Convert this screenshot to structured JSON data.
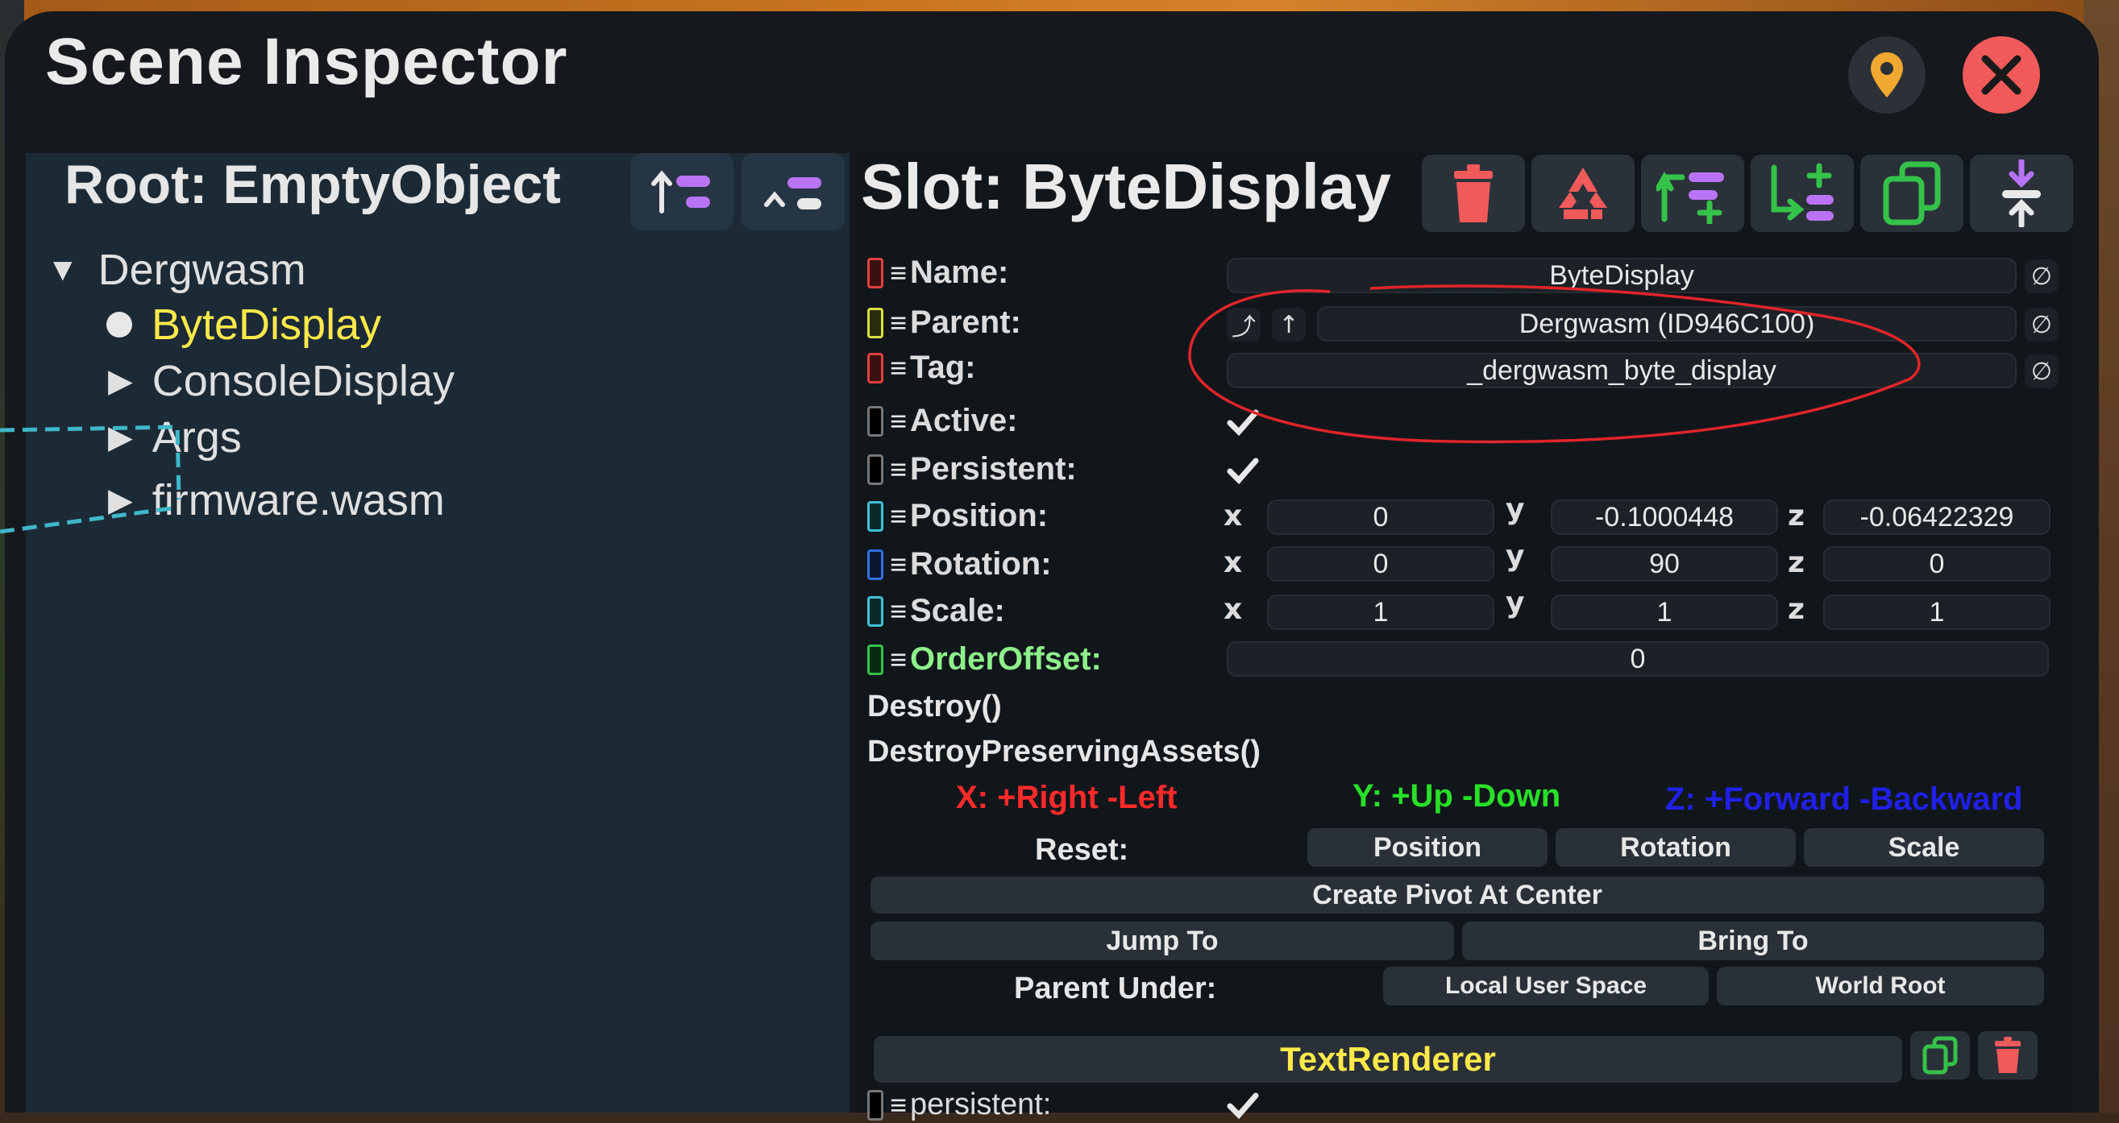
{
  "window": {
    "title": "Scene Inspector"
  },
  "colors": {
    "accent_yellow": "#ffe94a",
    "delete_red": "#f05a5a",
    "green_icon": "#35c24a",
    "purple_icon": "#b874f5",
    "highlight_circle": "#e0252a"
  },
  "hierarchy": {
    "root_label": "Root: EmptyObject",
    "items": [
      {
        "label": "Dergwasm",
        "expanded": true,
        "level": 0
      },
      {
        "label": "ByteDisplay",
        "selected": true,
        "level": 1
      },
      {
        "label": "ConsoleDisplay",
        "level": 1
      },
      {
        "label": "Args",
        "level": 1
      },
      {
        "label": "firmware.wasm",
        "level": 1
      }
    ]
  },
  "slot": {
    "title": "Slot: ByteDisplay",
    "toolbar_icons": [
      "delete-icon",
      "destroy-preserving-assets-icon",
      "insert-parent-icon",
      "add-child-icon",
      "duplicate-icon",
      "center-pivot-icon"
    ],
    "fields": {
      "name": {
        "label": "Name:",
        "value": "ByteDisplay"
      },
      "parent": {
        "label": "Parent:",
        "value": "Dergwasm (ID946C100)"
      },
      "tag": {
        "label": "Tag:",
        "value": "_dergwasm_byte_display"
      },
      "active": {
        "label": "Active:",
        "checked": true
      },
      "persistent": {
        "label": "Persistent:",
        "checked": true
      },
      "position": {
        "label": "Position:",
        "x": "0",
        "y": "-0.1000448",
        "z": "-0.06422329"
      },
      "rotation": {
        "label": "Rotation:",
        "x": "0",
        "y": "90",
        "z": "0"
      },
      "scale": {
        "label": "Scale:",
        "x": "1",
        "y": "1",
        "z": "1"
      },
      "order_offset": {
        "label": "OrderOffset:",
        "value": "0"
      }
    },
    "axis_letters": {
      "x": "x",
      "y": "y",
      "z": "z"
    },
    "methods": [
      "Destroy()",
      "DestroyPreservingAssets()"
    ],
    "legend": {
      "x": "X: +Right -Left",
      "y": "Y: +Up -Down",
      "z": "Z: +Forward -Backward"
    },
    "reset": {
      "label": "Reset:",
      "position": "Position",
      "rotation": "Rotation",
      "scale": "Scale"
    },
    "create_pivot": "Create Pivot At Center",
    "jump_to": "Jump To",
    "bring_to": "Bring To",
    "parent_under": {
      "label": "Parent Under:",
      "local_user_space": "Local User Space",
      "world_root": "World Root"
    }
  },
  "component": {
    "name": "TextRenderer",
    "first_field": {
      "label": "persistent:",
      "checked": true
    }
  }
}
